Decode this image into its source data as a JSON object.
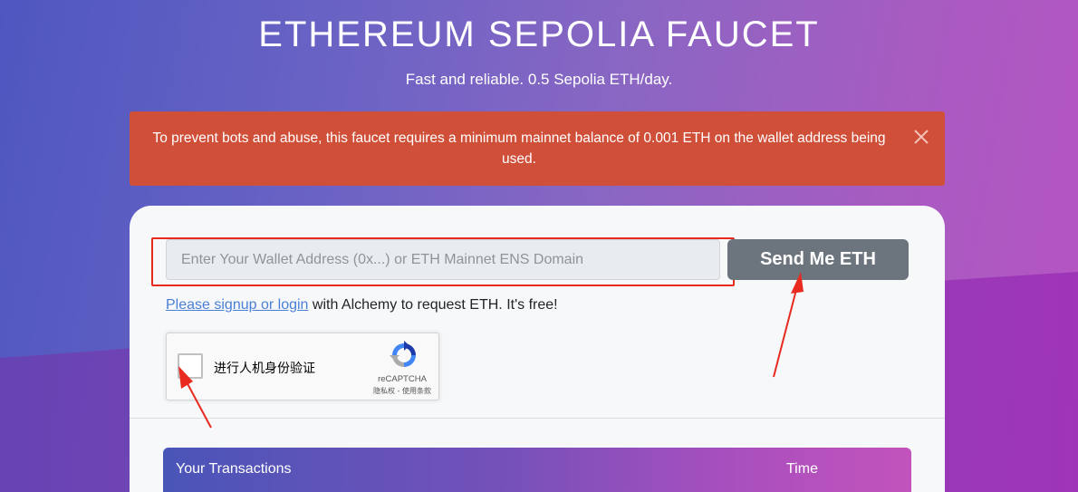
{
  "header": {
    "title": "ETHEREUM SEPOLIA FAUCET",
    "subtitle": "Fast and reliable. 0.5 Sepolia ETH/day."
  },
  "alert": {
    "message": "To prevent bots and abuse, this faucet requires a minimum mainnet balance of 0.001 ETH on the wallet address being used.",
    "close_icon": "close-icon",
    "color": "#d04f38"
  },
  "form": {
    "wallet_placeholder": "Enter Your Wallet Address (0x...) or ETH Mainnet ENS Domain",
    "wallet_value": "",
    "send_label": "Send Me ETH",
    "signup_link": "Please signup or login",
    "signup_rest": " with Alchemy to request ETH. It's free!"
  },
  "recaptcha": {
    "label": "进行人机身份验证",
    "brand": "reCAPTCHA",
    "terms": "隐私权 - 使用条款",
    "icon": "recaptcha-logo-icon"
  },
  "transactions": {
    "col_transactions": "Your Transactions",
    "col_time": "Time"
  },
  "colors": {
    "highlight": "#e82a1f",
    "link": "#4a7fd6",
    "button": "#6c757d"
  }
}
